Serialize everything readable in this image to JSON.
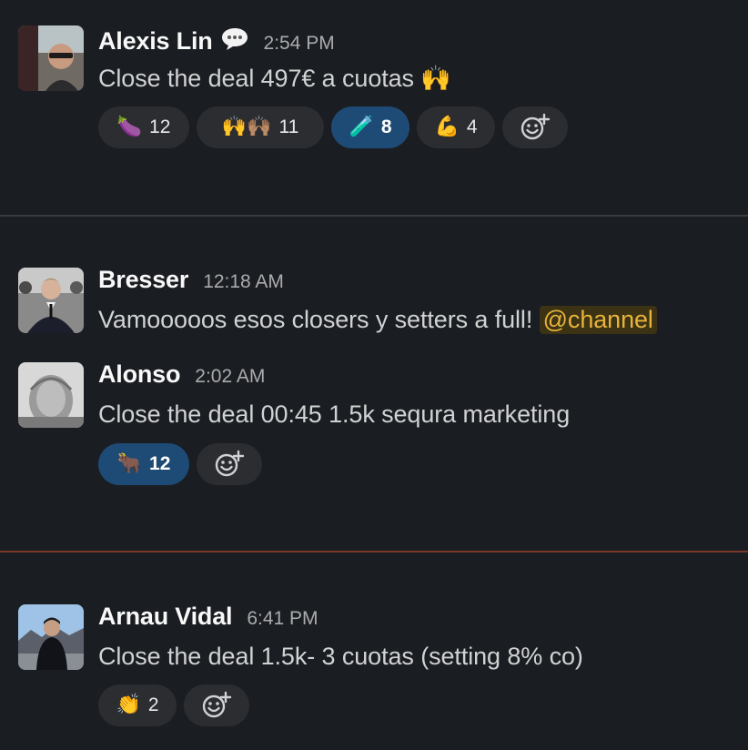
{
  "messages": [
    {
      "author": "Alexis Lin",
      "time": "2:54 PM",
      "status_icon": "speech-bubble-icon",
      "text": "Close the deal 497€ a cuotas 🙌",
      "reactions": [
        {
          "emoji": "🍆",
          "icon": "eggplant-icon",
          "count": "12",
          "active": false
        },
        {
          "emoji": "🙌🙌🏽",
          "icon": "raised-hands-icon",
          "count": "11",
          "active": false
        },
        {
          "emoji": "🧪",
          "icon": "test-tube-icon",
          "count": "8",
          "active": true
        },
        {
          "emoji": "💪",
          "icon": "flexed-biceps-icon",
          "count": "4",
          "active": false
        }
      ]
    },
    {
      "author": "Bresser",
      "time": "12:18 AM",
      "text_before": "Vamooooos esos closers y setters a full! ",
      "mention": "@channel"
    },
    {
      "author": "Alonso",
      "time": "2:02 AM",
      "text": "Close the deal 00:45 1.5k sequra marketing",
      "reactions": [
        {
          "emoji": "🐂",
          "icon": "ox-icon",
          "count": "12",
          "active": true
        }
      ]
    },
    {
      "author": "Arnau Vidal",
      "time": "6:41 PM",
      "text": "Close the deal 1.5k- 3 cuotas (setting 8% co)",
      "reactions": [
        {
          "emoji": "👏",
          "icon": "clapping-hands-icon",
          "count": "2",
          "active": false
        }
      ]
    }
  ],
  "colors": {
    "background": "#1a1d21",
    "divider_gray": "#3a3b3e",
    "divider_new": "#7a3a2a",
    "active_reaction": "#1e4b75",
    "mention_text": "#e8b33b"
  }
}
